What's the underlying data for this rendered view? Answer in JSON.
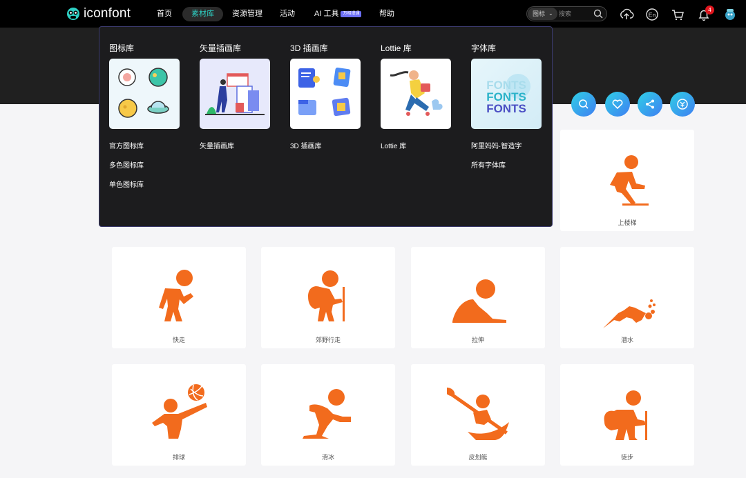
{
  "brand": {
    "name": "iconfont"
  },
  "nav": {
    "items": [
      {
        "label": "首页"
      },
      {
        "label": "素材库"
      },
      {
        "label": "资源管理"
      },
      {
        "label": "活动"
      },
      {
        "label": "AI 工具",
        "badge": "万相漫通"
      },
      {
        "label": "帮助"
      }
    ],
    "active_index": 1
  },
  "search": {
    "type": "图标",
    "placeholder": "搜索"
  },
  "notifications": {
    "count": "4"
  },
  "dropdown": {
    "columns": [
      {
        "title": "图标库",
        "links": [
          "官方图标库",
          "多色图标库",
          "单色图标库"
        ]
      },
      {
        "title": "矢量插画库",
        "links": [
          "矢量插画库"
        ]
      },
      {
        "title": "3D 插画库",
        "links": [
          "3D 插画库"
        ]
      },
      {
        "title": "Lottie 库",
        "links": [
          "Lottie 库"
        ]
      },
      {
        "title": "字体库",
        "links": [
          "阿里妈妈·智造字",
          "所有字体库"
        ],
        "preview_text": "FONTS"
      }
    ]
  },
  "actions": [
    "search-icon",
    "heart-icon",
    "share-icon",
    "reward-icon"
  ],
  "icon_color": "#f26b1d",
  "icons": [
    {
      "label": "上楼梯"
    },
    {
      "label": "快走"
    },
    {
      "label": "郊野行走"
    },
    {
      "label": "拉伸"
    },
    {
      "label": "潜水"
    },
    {
      "label": "排球"
    },
    {
      "label": "滑冰"
    },
    {
      "label": "皮划艇"
    },
    {
      "label": "徒步"
    }
  ]
}
